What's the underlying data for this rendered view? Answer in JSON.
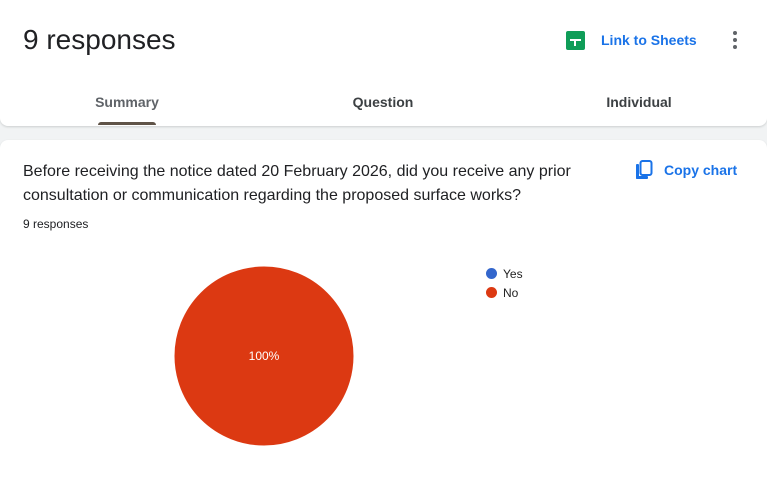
{
  "header": {
    "title": "9 responses",
    "sheets_label": "Link to Sheets",
    "sheets_icon": "google-sheets-icon",
    "more_icon": "more-vert-icon"
  },
  "tabs": [
    {
      "label": "Summary",
      "active": true
    },
    {
      "label": "Question",
      "active": false
    },
    {
      "label": "Individual",
      "active": false
    }
  ],
  "question": {
    "text": "Before receiving the notice dated 20 February 2026, did you receive any prior consultation or communication regarding the proposed surface works?",
    "response_count": "9 responses",
    "copy_label": "Copy chart",
    "copy_icon": "copy-icon"
  },
  "chart_data": {
    "type": "pie",
    "categories": [
      "Yes",
      "No"
    ],
    "values": [
      0,
      100
    ],
    "slice_labels": [
      "",
      "100%"
    ],
    "colors": [
      "#3366cc",
      "#dc3912"
    ],
    "legend_position": "right"
  }
}
